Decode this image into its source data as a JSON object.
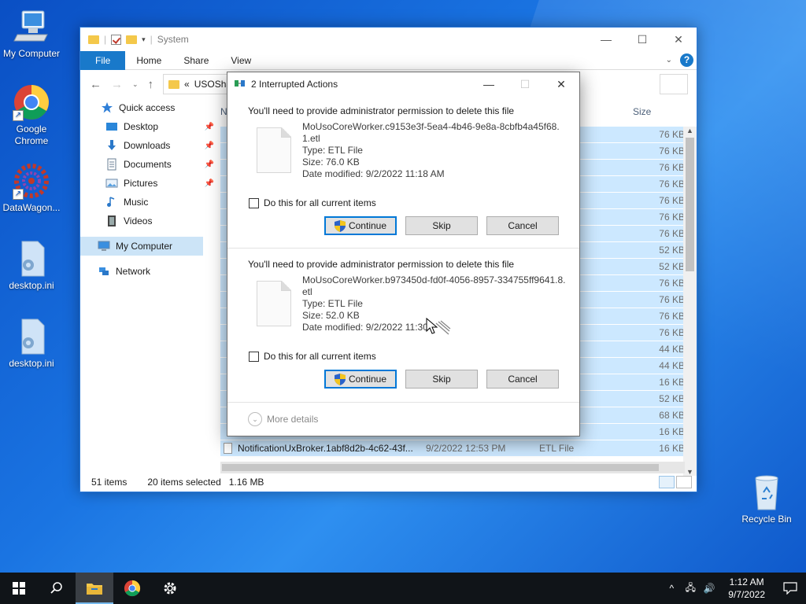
{
  "desktop": {
    "icons": [
      {
        "label": "My Computer"
      },
      {
        "label": "Google Chrome"
      },
      {
        "label": "DataWagon..."
      },
      {
        "label": "desktop.ini"
      },
      {
        "label": "desktop.ini"
      },
      {
        "label": "Recycle Bin"
      }
    ]
  },
  "explorer": {
    "title": "System",
    "ribbon_tabs": [
      "File",
      "Home",
      "Share",
      "View"
    ],
    "address": "USOSha",
    "address_prefix": "«",
    "nav": {
      "quick_access": "Quick access",
      "items": [
        "Desktop",
        "Downloads",
        "Documents",
        "Pictures",
        "Music",
        "Videos"
      ],
      "my_computer": "My Computer",
      "network": "Network"
    },
    "columns": {
      "name_partial": "N",
      "size": "Size"
    },
    "sizes": [
      "76 KB",
      "76 KB",
      "76 KB",
      "76 KB",
      "76 KB",
      "76 KB",
      "76 KB",
      "52 KB",
      "52 KB",
      "76 KB",
      "76 KB",
      "76 KB",
      "76 KB",
      "44 KB",
      "44 KB",
      "16 KB",
      "52 KB",
      "68 KB",
      "16 KB"
    ],
    "last_row": {
      "name": "NotificationUxBroker.1abf8d2b-4c62-43f...",
      "date": "9/2/2022 12:53 PM",
      "type": "ETL File",
      "size": "16 KB"
    },
    "status": {
      "items": "51 items",
      "selected": "20 items selected",
      "size": "1.16 MB"
    }
  },
  "dialog": {
    "title": "2 Interrupted Actions",
    "actions": [
      {
        "message": "You'll need to provide administrator permission to delete this file",
        "filename": "MoUsoCoreWorker.c9153e3f-5ea4-4b46-9e8a-8cbfb4a45f68.1.etl",
        "type": "Type: ETL File",
        "size": "Size: 76.0 KB",
        "modified": "Date modified: 9/2/2022 11:18 AM",
        "checkbox": "Do this for all current items",
        "continue": "Continue",
        "skip": "Skip",
        "cancel": "Cancel"
      },
      {
        "message": "You'll need to provide administrator permission to delete this file",
        "filename": "MoUsoCoreWorker.b973450d-fd0f-4056-8957-334755ff9641.8.etl",
        "type": "Type: ETL File",
        "size": "Size: 52.0 KB",
        "modified": "Date modified: 9/2/2022 11:30",
        "checkbox": "Do this for all current items",
        "continue": "Continue",
        "skip": "Skip",
        "cancel": "Cancel"
      }
    ],
    "more_details": "More details"
  },
  "taskbar": {
    "time": "1:12 AM",
    "date": "9/7/2022"
  },
  "colors": {
    "accent": "#1979ca",
    "selection": "#cce8ff",
    "taskbar": "#101418"
  }
}
